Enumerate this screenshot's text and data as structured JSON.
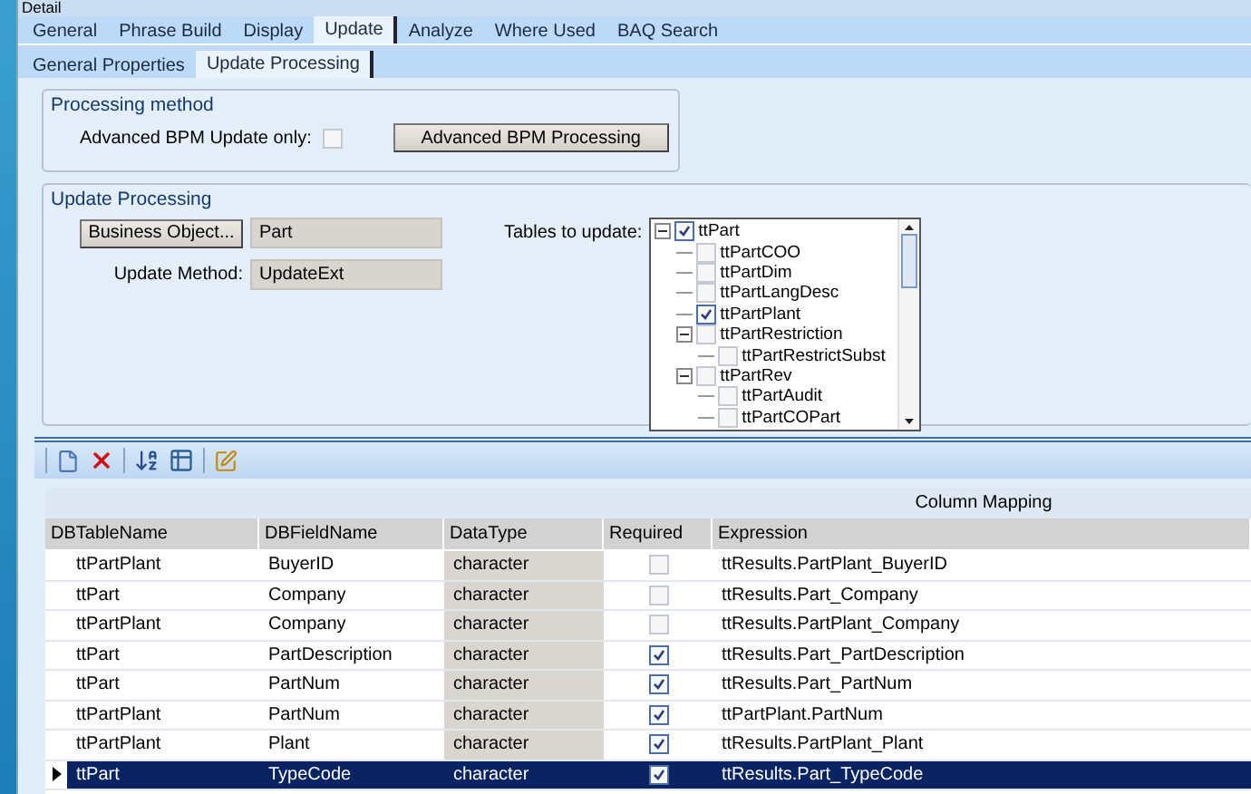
{
  "window": {
    "title": "Detail"
  },
  "tabs": [
    {
      "label": "General",
      "selected": false
    },
    {
      "label": "Phrase Build",
      "selected": false
    },
    {
      "label": "Display",
      "selected": false
    },
    {
      "label": "Update",
      "selected": true
    },
    {
      "label": "Analyze",
      "selected": false
    },
    {
      "label": "Where Used",
      "selected": false
    },
    {
      "label": "BAQ Search",
      "selected": false
    }
  ],
  "sub_tabs": [
    {
      "label": "General Properties",
      "selected": false
    },
    {
      "label": "Update Processing",
      "selected": true
    }
  ],
  "processing_method": {
    "title": "Processing method",
    "checkbox_label": "Advanced BPM Update only:",
    "checked": false,
    "button": "Advanced BPM Processing"
  },
  "update_processing": {
    "title": "Update Processing",
    "business_object_button": "Business Object...",
    "business_object": "Part",
    "update_method_label": "Update Method:",
    "update_method": "UpdateExt",
    "tables_label": "Tables to update:",
    "tables": [
      {
        "label": "ttPart",
        "checked": true,
        "expanded": true,
        "children": [
          {
            "label": "ttPartCOO",
            "checked": false
          },
          {
            "label": "ttPartDim",
            "checked": false
          },
          {
            "label": "ttPartLangDesc",
            "checked": false
          },
          {
            "label": "ttPartPlant",
            "checked": true
          },
          {
            "label": "ttPartRestriction",
            "checked": false,
            "expanded": true,
            "children": [
              {
                "label": "ttPartRestrictSubst",
                "checked": false
              }
            ]
          },
          {
            "label": "ttPartRev",
            "checked": false,
            "expanded": true,
            "children": [
              {
                "label": "ttPartAudit",
                "checked": false
              },
              {
                "label": "ttPartCOPart",
                "checked": false
              }
            ]
          }
        ]
      }
    ]
  },
  "grid": {
    "band_title": "Column Mapping",
    "columns": [
      "DBTableName",
      "DBFieldName",
      "DataType",
      "Required",
      "Expression"
    ],
    "rows": [
      {
        "table": "ttPartPlant",
        "field": "BuyerID",
        "type": "character",
        "required": false,
        "expression": "ttResults.PartPlant_BuyerID",
        "selected": false
      },
      {
        "table": "ttPart",
        "field": "Company",
        "type": "character",
        "required": false,
        "expression": "ttResults.Part_Company",
        "selected": false
      },
      {
        "table": "ttPartPlant",
        "field": "Company",
        "type": "character",
        "required": false,
        "expression": "ttResults.PartPlant_Company",
        "selected": false
      },
      {
        "table": "ttPart",
        "field": "PartDescription",
        "type": "character",
        "required": true,
        "expression": "ttResults.Part_PartDescription",
        "selected": false
      },
      {
        "table": "ttPart",
        "field": "PartNum",
        "type": "character",
        "required": true,
        "expression": "ttResults.Part_PartNum",
        "selected": false
      },
      {
        "table": "ttPartPlant",
        "field": "PartNum",
        "type": "character",
        "required": true,
        "expression": "ttPartPlant.PartNum",
        "selected": false
      },
      {
        "table": "ttPartPlant",
        "field": "Plant",
        "type": "character",
        "required": true,
        "expression": "ttResults.PartPlant_Plant",
        "selected": false
      },
      {
        "table": "ttPart",
        "field": "TypeCode",
        "type": "character",
        "required": true,
        "expression": "ttResults.Part_TypeCode",
        "selected": true
      }
    ]
  }
}
